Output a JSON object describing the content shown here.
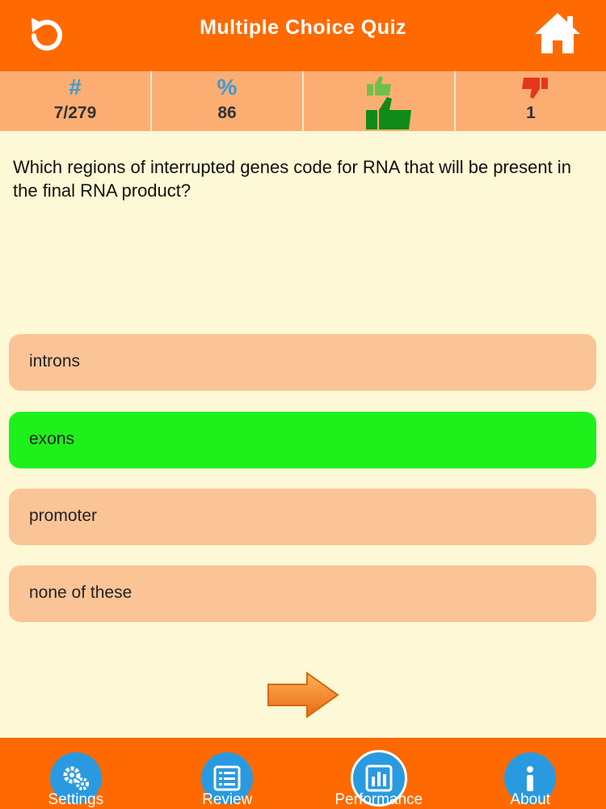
{
  "header": {
    "title": "Multiple Choice Quiz",
    "restart_icon": "restart-icon",
    "home_icon": "home-icon"
  },
  "stats": {
    "question_symbol": "#",
    "question_progress": "7/279",
    "percent_symbol": "%",
    "percent_value": "86",
    "correct_icon": "thumbs-up-icon",
    "wrong_icon": "thumbs-down-icon",
    "wrong_count": "1"
  },
  "question": {
    "text": "Which regions of interrupted genes code for RNA that will be present in the final RNA product?"
  },
  "answers": [
    {
      "label": "introns",
      "state": "default"
    },
    {
      "label": "exons",
      "state": "correct"
    },
    {
      "label": "promoter",
      "state": "default"
    },
    {
      "label": "none of these",
      "state": "default"
    }
  ],
  "next_icon": "arrow-right-icon",
  "bottom_nav": [
    {
      "label": "Settings",
      "icon": "gears-icon"
    },
    {
      "label": "Review",
      "icon": "list-icon"
    },
    {
      "label": "Performance",
      "icon": "bar-chart-icon",
      "active": true
    },
    {
      "label": "About",
      "icon": "info-icon"
    }
  ],
  "colors": {
    "primary": "#ff6a00",
    "stats_bg": "#fcae72",
    "answer_bg": "#fbc497",
    "correct": "#1ef01c",
    "background": "#fdf8d5",
    "accent_blue": "#2a9ae0"
  }
}
